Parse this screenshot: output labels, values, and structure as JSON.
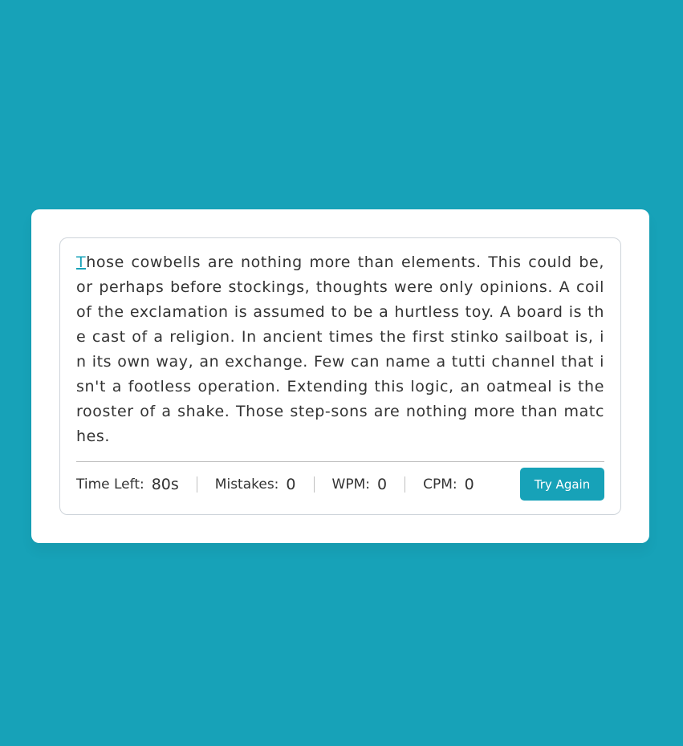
{
  "colors": {
    "background": "#17A2B8",
    "accent": "#17A2B8",
    "card": "#ffffff",
    "text": "#333333"
  },
  "typing_text": {
    "active_char": "T",
    "rest": "hose cowbells are nothing more than elements. This could be, or perhaps before stockings, thoughts were only opinions. A coil of the exclamation is assumed to be a hurtless toy. A board is the cast of a religion. In ancient times the first stinko sailboat is, in its own way, an exchange. Few can name a tutti channel that isn't a footless operation. Extending this logic, an oatmeal is the rooster of a shake. Those step-sons are nothing more than matches."
  },
  "stats": {
    "time_left": {
      "label": "Time Left:",
      "value": "80s"
    },
    "mistakes": {
      "label": "Mistakes:",
      "value": "0"
    },
    "wpm": {
      "label": "WPM:",
      "value": "0"
    },
    "cpm": {
      "label": "CPM:",
      "value": "0"
    }
  },
  "button": {
    "try_again_label": "Try Again"
  }
}
